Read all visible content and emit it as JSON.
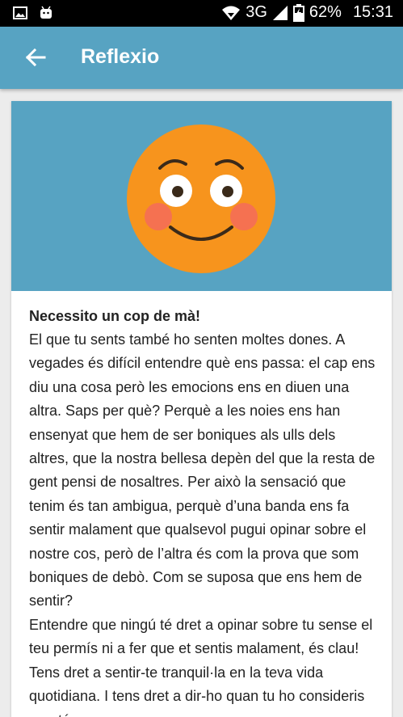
{
  "status_bar": {
    "network": "3G",
    "battery": "62%",
    "time": "15:31"
  },
  "app_bar": {
    "title": "Reflexio",
    "back_icon": "arrow-left-icon"
  },
  "card": {
    "image_icon": "blushing-smiley-face",
    "heading": "Necessito un cop de mà!",
    "paragraphs": [
      "El que tu sents també ho senten moltes dones. A vegades és difícil entendre què ens passa: el cap ens diu una cosa però les emocions ens en diuen una altra. Saps per què? Perquè a les noies ens han ensenyat que hem de ser boniques als ulls dels altres, que la nostra bellesa depèn del que la resta de gent pensi de nosaltres. Per això la sensació que tenim és tan ambigua, perquè d’una banda ens fa sentir malament que qualsevol pugui opinar sobre el nostre cos, però de l’altra és com la prova que som boniques de debò. Com se suposa que ens hem de sentir?",
      "Entendre que ningú té dret a opinar sobre tu sense el teu permís ni a fer que et sentis malament, és clau! Tens dret a sentir-te tranquil·la en la teva vida quotidiana. I tens dret a dir-ho quan tu ho consideris oportú."
    ]
  },
  "colors": {
    "app_bar": "#57a3c2",
    "face": "#f7941d",
    "cheeks": "#f46b5b"
  }
}
